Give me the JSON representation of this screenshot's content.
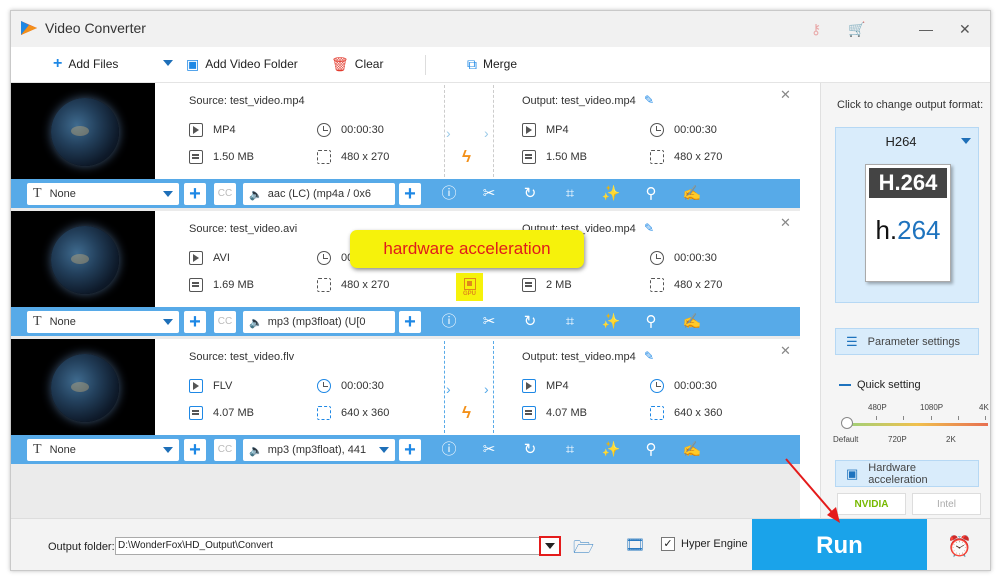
{
  "app": {
    "title": "Video Converter"
  },
  "toolbar": {
    "add_files": "Add Files",
    "add_folder": "Add Video Folder",
    "clear": "Clear",
    "merge": "Merge"
  },
  "items": [
    {
      "source": "Source: test_video.mp4",
      "src_format": "MP4",
      "src_duration": "00:00:30",
      "src_size": "1.50 MB",
      "src_res": "480 x 270",
      "output": "Output: test_video.mp4",
      "out_format": "MP4",
      "out_duration": "00:00:30",
      "out_size": "1.50 MB",
      "out_res": "480 x 270",
      "subtitle": "None",
      "audio": "aac (LC) (mp4a / 0x6"
    },
    {
      "source": "Source: test_video.avi",
      "src_format": "AVI",
      "src_duration": "00",
      "src_size": "1.69 MB",
      "src_res": "480 x 270",
      "output": "Output: test_video.mp4",
      "out_format": "",
      "out_duration": "00:00:30",
      "out_size": "2 MB",
      "out_res": "480 x 270",
      "subtitle": "None",
      "audio": "mp3 (mp3float) (U[0"
    },
    {
      "source": "Source: test_video.flv",
      "src_format": "FLV",
      "src_duration": "00:00:30",
      "src_size": "4.07 MB",
      "src_res": "640 x 360",
      "output": "Output: test_video.mp4",
      "out_format": "MP4",
      "out_duration": "00:00:30",
      "out_size": "4.07 MB",
      "out_res": "640 x 360",
      "subtitle": "None",
      "audio": "mp3 (mp3float), 441"
    }
  ],
  "right_panel": {
    "click_label": "Click to change output format:",
    "format": "H264",
    "logo_top": "H.264",
    "logo_bottom_a": "h.",
    "logo_bottom_b": "264",
    "parameter_settings": "Parameter settings",
    "quick_setting": "Quick setting",
    "scale_top": [
      "480P",
      "1080P",
      "4K"
    ],
    "scale_bottom": [
      "Default",
      "720P",
      "2K"
    ],
    "hardware_acceleration": "Hardware acceleration",
    "nvidia": "NVIDIA",
    "intel": "Intel"
  },
  "bottom": {
    "output_folder_label": "Output folder:",
    "output_folder_value": "D:\\WonderFox\\HD_Output\\Convert",
    "hyper_engine": "Hyper Engine",
    "hyper_checked": "✓",
    "run": "Run"
  },
  "callout": {
    "text": "hardware acceleration",
    "gpu": "GPU"
  },
  "colors": {
    "accent": "#1aa3ea",
    "bar": "#57aae8",
    "callout_bg": "#f6f20b",
    "callout_text": "#e01b1b",
    "highlight": "#e41b1b"
  }
}
